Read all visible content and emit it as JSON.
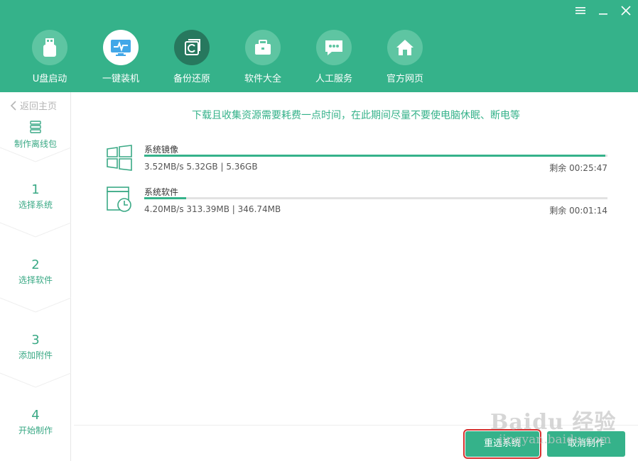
{
  "window": {
    "menu_icon": "menu-icon",
    "min_icon": "minimize-icon",
    "close_icon": "close-icon"
  },
  "nav": [
    {
      "label": "U盘启动",
      "icon": "usb-icon"
    },
    {
      "label": "一键装机",
      "icon": "monitor-icon"
    },
    {
      "label": "备份还原",
      "icon": "backup-icon"
    },
    {
      "label": "软件大全",
      "icon": "briefcase-icon"
    },
    {
      "label": "人工服务",
      "icon": "chat-icon"
    },
    {
      "label": "官方网页",
      "icon": "home-icon"
    }
  ],
  "sidebar": {
    "back": "返回主页",
    "current": "制作离线包",
    "steps": [
      {
        "num": "1",
        "label": "选择系统"
      },
      {
        "num": "2",
        "label": "选择软件"
      },
      {
        "num": "3",
        "label": "添加附件"
      },
      {
        "num": "4",
        "label": "开始制作"
      }
    ]
  },
  "main": {
    "notice": "下载且收集资源需要耗费一点时间，在此期间尽量不要使电脑休眠、断电等",
    "downloads": [
      {
        "name": "系统镜像",
        "stats": "3.52MB/s 5.32GB | 5.36GB",
        "remaining": "剩余 00:25:47",
        "progress": 0.995,
        "icon": "windows-icon"
      },
      {
        "name": "系统软件",
        "stats": "4.20MB/s 313.39MB | 346.74MB",
        "remaining": "剩余 00:01:14",
        "progress": 0.09,
        "icon": "software-clock-icon"
      }
    ]
  },
  "buttons": {
    "reselect": "重选系统",
    "cancel": "取消制作"
  },
  "watermark": {
    "big": "Baidu 经验",
    "small": "jingyan.baidu.com"
  },
  "colors": {
    "brand": "#35b28a",
    "highlight": "#d6302f"
  }
}
